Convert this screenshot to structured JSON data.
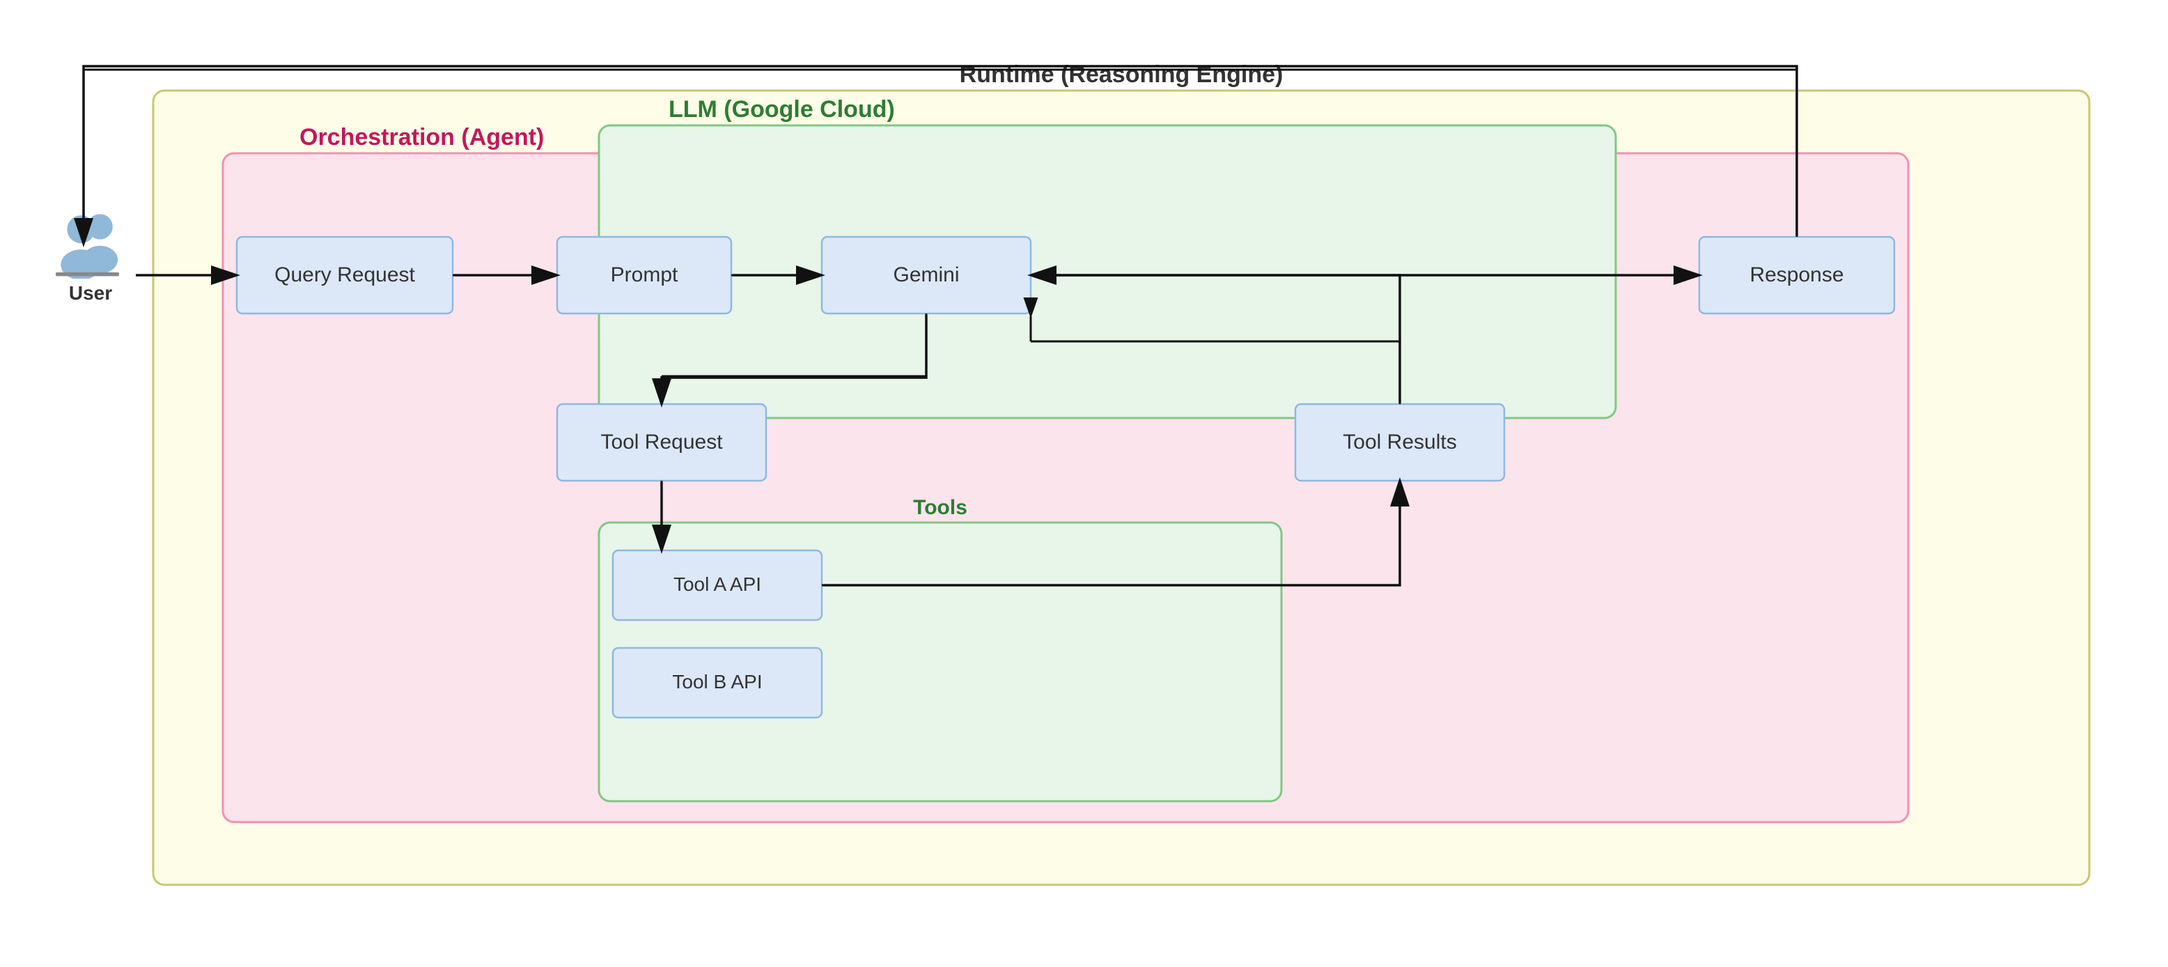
{
  "diagram": {
    "runtime_label": "Runtime (Reasoning Engine)",
    "orchestration_label": "Orchestration (Agent)",
    "llm_label": "LLM (Google Cloud)",
    "tools_section_label": "Tools",
    "user_label": "User",
    "boxes": {
      "query_request": "Query Request",
      "prompt": "Prompt",
      "gemini": "Gemini",
      "response": "Response",
      "tool_request": "Tool Request",
      "tool_results": "Tool Results",
      "tool_a": "Tool A API",
      "tool_b": "Tool B API"
    }
  }
}
